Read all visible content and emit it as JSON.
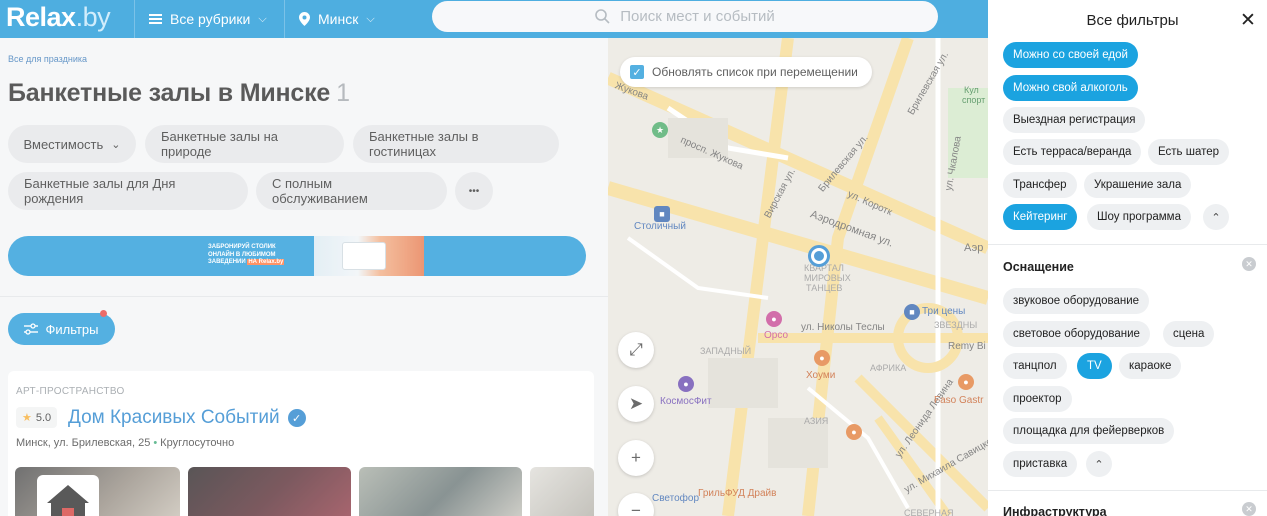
{
  "header": {
    "logo": "Relax",
    "logo_suffix": ".by",
    "rubrics": "Все рубрики",
    "city": "Минск",
    "search_placeholder": "Поиск мест и событий"
  },
  "breadcrumb": "Все для праздника",
  "page": {
    "title": "Банкетные залы в Минске",
    "count": "1"
  },
  "chips": [
    "Вместимость",
    "Банкетные залы на природе",
    "Банкетные залы в гостиницах",
    "Банкетные залы для Дня рождения",
    "С полным обслуживанием",
    "•••"
  ],
  "banner": {
    "line1": "ЗАБРОНИРУЙ СТОЛИК",
    "line2": "ОНЛАЙН В ЛЮБИМОМ",
    "line3": "ЗАВЕДЕНИИ",
    "highlight": "НА Relax.by"
  },
  "filters_button": "Фильтры",
  "card": {
    "category": "АРТ-ПРОСТРАНСТВО",
    "rating": "5.0",
    "name": "Дом Красивых Событий",
    "address": "Минск, ул. Брилевская, 25",
    "hours": "Круглосуточно"
  },
  "map": {
    "update_label": "Обновлять список при перемещении",
    "labels": [
      "Жукова",
      "просп. Жукова",
      "Вирская ул.",
      "Брилевская ул.",
      "ул. Коротк",
      "Аэродромная ул.",
      "Брилевская ул.",
      "Столичный",
      "КВАРТАЛ",
      "МИРОВЫХ",
      "ТАНЦЕВ",
      "Три цены",
      "Орсо",
      "ул. Николы Теслы",
      "ЗАПАДНЫЙ",
      "Хоуми",
      "АФРИКА",
      "КосмосФит",
      "АЗИЯ",
      "ул. Леонида Левина",
      "ул. Михаила Савицкого",
      "ГрильФУД Драйв",
      "Светофор",
      "Remy Bi",
      "Faso Gastr",
      "ЗВЕЗДНЫ",
      "Кул",
      "спорт",
      "ул. Чкалова",
      "СЕВЕРНАЯ",
      "Аэр"
    ]
  },
  "panel": {
    "title": "Все фильтры",
    "top_tags": [
      {
        "label": "Можно со своей едой",
        "active": true
      },
      {
        "label": "Можно свой алкоголь",
        "active": true
      },
      {
        "label": "Выездная регистрация",
        "active": false
      },
      {
        "label": "Есть терраса/веранда",
        "active": false
      },
      {
        "label": "Есть шатер",
        "active": false
      },
      {
        "label": "Трансфер",
        "active": false
      },
      {
        "label": "Украшение зала",
        "active": false
      },
      {
        "label": "Кейтеринг",
        "active": true
      },
      {
        "label": "Шоу программа",
        "active": false
      }
    ],
    "equipment_title": "Оснащение",
    "equipment_tags": [
      {
        "label": "звуковое оборудование",
        "active": false
      },
      {
        "label": "световое оборудование",
        "active": false
      },
      {
        "label": "сцена",
        "active": false
      },
      {
        "label": "танцпол",
        "active": false
      },
      {
        "label": "TV",
        "active": true
      },
      {
        "label": "караоке",
        "active": false
      },
      {
        "label": "проектор",
        "active": false
      },
      {
        "label": "площадка для фейерверков",
        "active": false
      },
      {
        "label": "приставка",
        "active": false
      }
    ],
    "infra_title": "Инфраструктура"
  },
  "colors": {
    "brand": "#0b8fd4",
    "accent": "#1ba3e0",
    "link": "#1479c8"
  }
}
